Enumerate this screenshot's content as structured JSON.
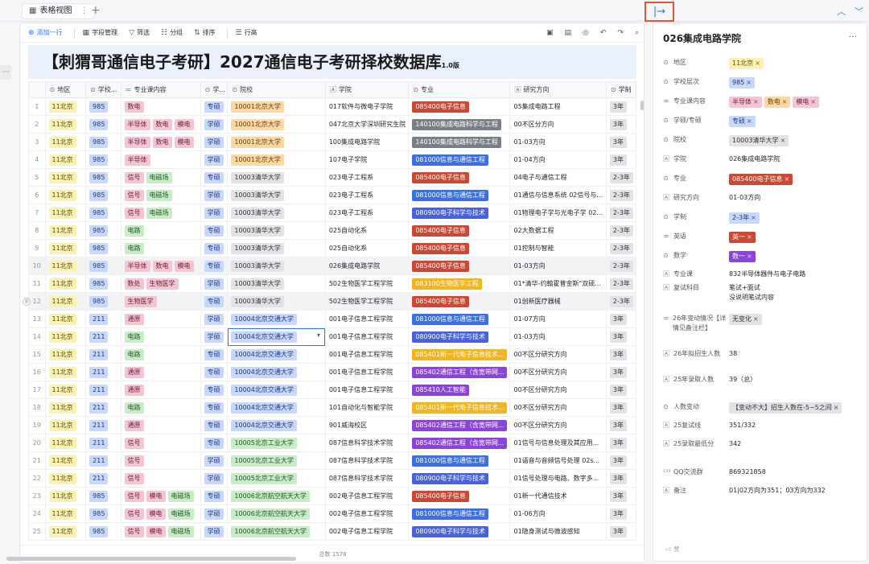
{
  "tab": {
    "label": "表格视图",
    "add": "+"
  },
  "toolbar": {
    "add_row": "添加一行",
    "fields": "字段管理",
    "filter": "筛选",
    "group": "分组",
    "sort": "排序",
    "row_height": "行高"
  },
  "banner": {
    "title": "【刺猬哥通信电子考研】2027通信电子考研择校数据库",
    "version": "1.0版"
  },
  "columns": [
    "地区",
    "学校...",
    "专业课内容",
    "学...",
    "院校",
    "学院",
    "专业",
    "研究方向",
    "学制"
  ],
  "rows": [
    {
      "n": "1",
      "region": "11北京",
      "level": "985",
      "subjects": [
        [
          "数电",
          "pink"
        ]
      ],
      "type": "专硕",
      "school": [
        "10001北京大学",
        "orange"
      ],
      "college": "017软件与微电子学院",
      "major": [
        "085400电子信息",
        "red"
      ],
      "dir": "05集成电路工程",
      "dur": "3年"
    },
    {
      "n": "2",
      "region": "11北京",
      "level": "985",
      "subjects": [
        [
          "半导体",
          "pink"
        ],
        [
          "数电",
          "pink"
        ],
        [
          "模电",
          "pink"
        ]
      ],
      "type": "学硕",
      "school": [
        "10001北京大学",
        "orange"
      ],
      "college": "047北京大学深圳研究生院",
      "major": [
        "140100集成电路科学与工程",
        "slate"
      ],
      "dir": "00不区分方向",
      "dur": "3年"
    },
    {
      "n": "3",
      "region": "11北京",
      "level": "985",
      "subjects": [
        [
          "半导体",
          "pink"
        ],
        [
          "数电",
          "pink"
        ],
        [
          "模电",
          "pink"
        ]
      ],
      "type": "学硕",
      "school": [
        "10001北京大学",
        "orange"
      ],
      "college": "100集成电路学院",
      "major": [
        "140100集成电路科学与工程",
        "slate"
      ],
      "dir": "01-03方向",
      "dur": "3年"
    },
    {
      "n": "4",
      "region": "11北京",
      "level": "985",
      "subjects": [
        [
          "半导体",
          "pink"
        ]
      ],
      "type": "学硕",
      "school": [
        "10001北京大学",
        "orange"
      ],
      "college": "107电子学院",
      "major": [
        "081000信息与通信工程",
        "blue2"
      ],
      "dir": "01-04方向",
      "dur": "3年"
    },
    {
      "n": "5",
      "region": "11北京",
      "level": "985",
      "subjects": [
        [
          "信号",
          "pink"
        ],
        [
          "电磁场",
          "green"
        ]
      ],
      "type": "专硕",
      "school": [
        "10003清华大学",
        "gray"
      ],
      "college": "023电子工程系",
      "major": [
        "085400电子信息",
        "red"
      ],
      "dir": "04电子与通信工程",
      "dur": "2-3年"
    },
    {
      "n": "6",
      "region": "11北京",
      "level": "985",
      "subjects": [
        [
          "信号",
          "pink"
        ],
        [
          "电磁场",
          "green"
        ]
      ],
      "type": "学硕",
      "school": [
        "10003清华大学",
        "gray"
      ],
      "college": "023电子工程系",
      "major": [
        "081000信息与通信工程",
        "blue2"
      ],
      "dir": "01通信与信息系统 02信号与...",
      "dur": "2-3年"
    },
    {
      "n": "7",
      "region": "11北京",
      "level": "985",
      "subjects": [
        [
          "信号",
          "pink"
        ],
        [
          "电磁场",
          "green"
        ]
      ],
      "type": "学硕",
      "school": [
        "10003清华大学",
        "gray"
      ],
      "college": "023电子工程系",
      "major": [
        "080900电子科学与技术",
        "navy"
      ],
      "dir": "01物理电子学与光电子学 02...",
      "dur": "2-3年"
    },
    {
      "n": "8",
      "region": "11北京",
      "level": "985",
      "subjects": [
        [
          "电路",
          "green"
        ]
      ],
      "type": "专硕",
      "school": [
        "10003清华大学",
        "gray"
      ],
      "college": "025自动化系",
      "major": [
        "085400电子信息",
        "red"
      ],
      "dir": "02大数据工程",
      "dur": "2-3年"
    },
    {
      "n": "9",
      "region": "11北京",
      "level": "985",
      "subjects": [
        [
          "电路",
          "green"
        ]
      ],
      "type": "专硕",
      "school": [
        "10003清华大学",
        "gray"
      ],
      "college": "025自动化系",
      "major": [
        "085400电子信息",
        "red"
      ],
      "dir": "01控制与智能",
      "dur": "2-3年"
    },
    {
      "n": "10",
      "region": "11北京",
      "level": "985",
      "subjects": [
        [
          "半导体",
          "pink"
        ],
        [
          "数电",
          "pink"
        ],
        [
          "模电",
          "pink"
        ]
      ],
      "type": "专硕",
      "school": [
        "10003清华大学",
        "gray"
      ],
      "college": "026集成电路学院",
      "major": [
        "085400电子信息",
        "red"
      ],
      "dir": "01-03方向",
      "dur": "2-3年",
      "hl": true
    },
    {
      "n": "11",
      "region": "11北京",
      "level": "985",
      "subjects": [
        [
          "数处",
          "pink"
        ],
        [
          "生物医学",
          "pink"
        ]
      ],
      "type": "学硕",
      "school": [
        "10003清华大学",
        "gray"
      ],
      "college": "502生物医学工程学院",
      "major": [
        "083100生物医学工程",
        "amber"
      ],
      "dir": "01*清华-约翰霍普金斯\"双硕...",
      "dur": "2-3年"
    },
    {
      "n": "12",
      "region": "11北京",
      "level": "985",
      "subjects": [
        [
          "生物医学",
          "pink"
        ]
      ],
      "type": "专硕",
      "school": [
        "10003清华大学",
        "gray"
      ],
      "college": "502生物医学工程学院",
      "major": [
        "085400电子信息",
        "red"
      ],
      "dir": "01创新医疗器械",
      "dur": "2-3年",
      "hl": true
    },
    {
      "n": "13",
      "region": "11北京",
      "level": "211",
      "subjects": [
        [
          "通原",
          "pink"
        ]
      ],
      "type": "学硕",
      "school": [
        "10004北京交通大学",
        "blue"
      ],
      "college": "001电子信息工程学院",
      "major": [
        "081000信息与通信工程",
        "blue2"
      ],
      "dir": "01-07方向",
      "dur": "3年"
    },
    {
      "n": "14",
      "region": "11北京",
      "level": "211",
      "subjects": [
        [
          "电路",
          "green"
        ]
      ],
      "type": "学硕",
      "school": [
        "10004北京交通大学",
        "blue"
      ],
      "college": "001电子信息工程学院",
      "major": [
        "080900电子科学与技术",
        "navy"
      ],
      "dir": "01-03方向",
      "dur": "3年",
      "sel": true
    },
    {
      "n": "15",
      "region": "11北京",
      "level": "211",
      "subjects": [
        [
          "电路",
          "green"
        ]
      ],
      "type": "专硕",
      "school": [
        "10004北京交通大学",
        "blue"
      ],
      "college": "001电子信息工程学院",
      "major": [
        "085401新一代电子信息技术...",
        "amber"
      ],
      "dir": "00不区分研究方向",
      "dur": "3年"
    },
    {
      "n": "16",
      "region": "11北京",
      "level": "211",
      "subjects": [
        [
          "通原",
          "pink"
        ]
      ],
      "type": "专硕",
      "school": [
        "10004北京交通大学",
        "blue"
      ],
      "college": "001电子信息工程学院",
      "major": [
        "085402通信工程（含宽带网...",
        "purple"
      ],
      "dir": "00不区分研究方向",
      "dur": "3年"
    },
    {
      "n": "17",
      "region": "11北京",
      "level": "211",
      "subjects": [
        [
          "通原",
          "pink"
        ]
      ],
      "type": "专硕",
      "school": [
        "10004北京交通大学",
        "blue"
      ],
      "college": "001电子信息工程学院",
      "major": [
        "085410人工智能",
        "purple"
      ],
      "dir": "00不区分研究方向",
      "dur": "3年"
    },
    {
      "n": "18",
      "region": "11北京",
      "level": "211",
      "subjects": [
        [
          "电路",
          "green"
        ]
      ],
      "type": "专硕",
      "school": [
        "10004北京交通大学",
        "blue"
      ],
      "college": "101自动化与智能学院",
      "major": [
        "085401新一代电子信息技术...",
        "amber"
      ],
      "dir": "00不区分研究方向",
      "dur": "3年"
    },
    {
      "n": "19",
      "region": "11北京",
      "level": "211",
      "subjects": [
        [
          "通原",
          "pink"
        ]
      ],
      "type": "专硕",
      "school": [
        "10004北京交通大学",
        "blue"
      ],
      "college": "901威海校区",
      "major": [
        "085402通信工程（含宽带网...",
        "purple"
      ],
      "dir": "00不区分研究方向",
      "dur": "3年"
    },
    {
      "n": "20",
      "region": "11北京",
      "level": "211",
      "subjects": [
        [
          "信号",
          "pink"
        ]
      ],
      "type": "专硕",
      "school": [
        "10005北京工业大学",
        "green"
      ],
      "college": "087信息科学技术学院",
      "major": [
        "085402通信工程（含宽带网...",
        "purple"
      ],
      "dir": "01信号与信息处理及其应用...",
      "dur": "3年"
    },
    {
      "n": "21",
      "region": "11北京",
      "level": "211",
      "subjects": [
        [
          "信号",
          "pink"
        ]
      ],
      "type": "学硕",
      "school": [
        "10005北京工业大学",
        "green"
      ],
      "college": "087信息科学技术学院",
      "major": [
        "081000信息与通信工程",
        "blue2"
      ],
      "dir": "01语音与音频信号处理 02s...",
      "dur": "3年"
    },
    {
      "n": "22",
      "region": "11北京",
      "level": "211",
      "subjects": [
        [
          "信号",
          "pink"
        ]
      ],
      "type": "学硕",
      "school": [
        "10005北京工业大学",
        "green"
      ],
      "college": "087信息科学技术学院",
      "major": [
        "080900电子科学与技术",
        "navy"
      ],
      "dir": "01信号处理与电路、数字多...",
      "dur": "3年"
    },
    {
      "n": "23",
      "region": "11北京",
      "level": "985",
      "subjects": [
        [
          "信号",
          "pink"
        ],
        [
          "模电",
          "pink"
        ],
        [
          "电磁场",
          "green"
        ]
      ],
      "type": "专硕",
      "school": [
        "10006北京航空航天大学",
        "green"
      ],
      "college": "002电子信息工程学院",
      "major": [
        "085400电子信息",
        "red"
      ],
      "dir": "01新一代通信技术",
      "dur": "3年"
    },
    {
      "n": "24",
      "region": "11北京",
      "level": "985",
      "subjects": [
        [
          "信号",
          "pink"
        ],
        [
          "模电",
          "pink"
        ],
        [
          "电磁场",
          "green"
        ]
      ],
      "type": "学硕",
      "school": [
        "10006北京航空航天大学",
        "green"
      ],
      "college": "002电子信息工程学院",
      "major": [
        "081000信息与通信工程",
        "blue2"
      ],
      "dir": "01-06方向",
      "dur": "3年"
    },
    {
      "n": "25",
      "region": "11北京",
      "level": "985",
      "subjects": [
        [
          "信号",
          "pink"
        ],
        [
          "模电",
          "pink"
        ],
        [
          "电磁场",
          "green"
        ]
      ],
      "type": "学硕",
      "school": [
        "10006北京航空航天大学",
        "green"
      ],
      "college": "002电子信息工程学院",
      "major": [
        "080900电子科学与技术",
        "navy"
      ],
      "dir": "01隐身测试与微波感知",
      "dur": "3年"
    }
  ],
  "total": "总数 1578",
  "panel": {
    "title": "026集成电路学院",
    "fields": [
      {
        "label": "地区",
        "icon": "select-icon",
        "tags": [
          [
            "11北京",
            "yellow"
          ]
        ]
      },
      {
        "label": "学校层次",
        "icon": "select-icon",
        "tags": [
          [
            "985",
            "blue"
          ]
        ]
      },
      {
        "label": "专业课内容",
        "icon": "multiselect-icon",
        "tags": [
          [
            "半导体",
            "pink"
          ],
          [
            "数电",
            "orange"
          ],
          [
            "模电",
            "pink"
          ]
        ]
      },
      {
        "label": "学硕/专硕",
        "icon": "select-icon",
        "tags": [
          [
            "专硕",
            "blue"
          ]
        ]
      },
      {
        "label": "院校",
        "icon": "select-icon",
        "tags": [
          [
            "10003清华大学",
            "gray"
          ]
        ]
      },
      {
        "label": "学院",
        "icon": "text-icon",
        "text": "026集成电路学院"
      },
      {
        "label": "专业",
        "icon": "select-icon",
        "tags": [
          [
            "085400电子信息",
            "red"
          ]
        ]
      },
      {
        "label": "研究方向",
        "icon": "text-icon",
        "text": "01-03方向"
      },
      {
        "label": "学制",
        "icon": "select-icon",
        "tags": [
          [
            "2-3年",
            "blue"
          ]
        ]
      },
      {
        "label": "英语",
        "icon": "multiselect-icon",
        "tags": [
          [
            "英一",
            "red"
          ]
        ]
      },
      {
        "label": "数学",
        "icon": "select-icon",
        "tags": [
          [
            "数一",
            "purple"
          ]
        ]
      },
      {
        "label": "专业课",
        "icon": "text-icon",
        "text": "832半导体器件与电子电路"
      },
      {
        "label": "复试科目",
        "icon": "text-icon",
        "text": "笔试+面试\n没说明笔试内容"
      },
      {
        "label": "26年变动情况【详情见备注栏】",
        "icon": "multiselect-icon",
        "tags": [
          [
            "无变化",
            "gray"
          ]
        ]
      },
      {
        "label": "26年拟招生人数",
        "icon": "text-icon",
        "text": "38"
      },
      {
        "label": "25年录取人数",
        "icon": "text-icon",
        "text": "39（总）"
      },
      {
        "label": "人数变动",
        "icon": "select-icon",
        "tags": [
          [
            "【变动不大】招生人数在-5~5之间",
            "gray"
          ]
        ]
      },
      {
        "label": "25复试线",
        "icon": "text-icon",
        "text": "351/332"
      },
      {
        "label": "25录取最低分",
        "icon": "text-icon",
        "text": "342"
      },
      {
        "label": "QQ交流群",
        "icon": "number-icon",
        "text": "869321858"
      },
      {
        "label": "备注",
        "icon": "text-icon",
        "text": "01|02方向为351；03方向为332"
      }
    ],
    "like": "赞"
  }
}
